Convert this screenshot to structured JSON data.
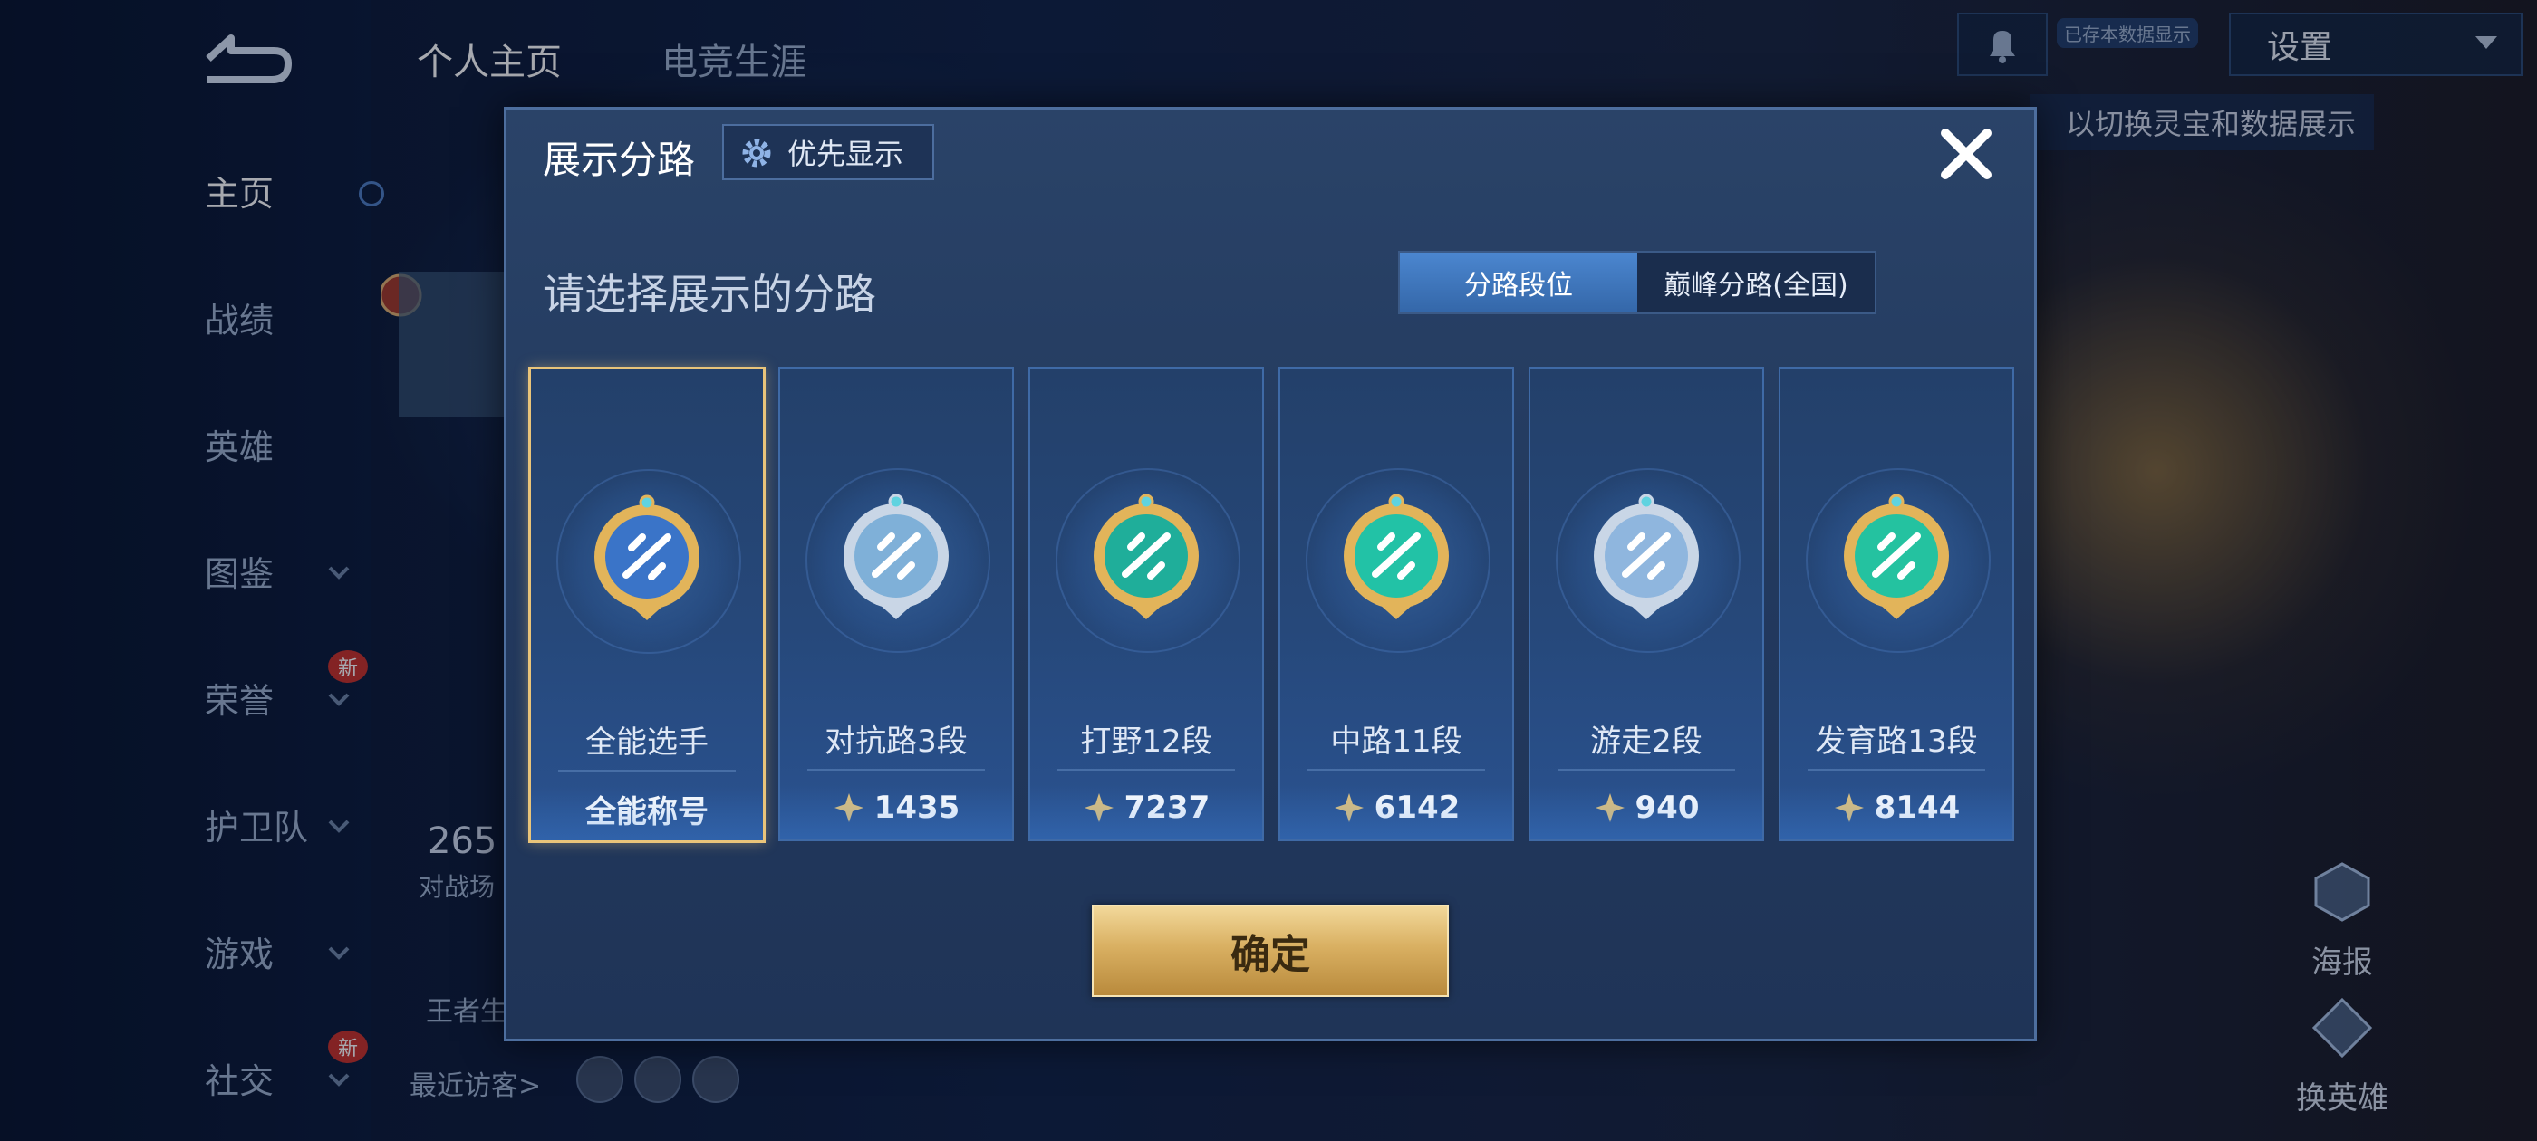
{
  "left_nav": {
    "items": [
      {
        "label": "主页",
        "active": true
      },
      {
        "label": "战绩"
      },
      {
        "label": "英雄"
      },
      {
        "label": "图鉴",
        "has_chevron": true
      },
      {
        "label": "荣誉",
        "has_chevron": true,
        "badge": "新"
      },
      {
        "label": "护卫队",
        "has_chevron": true
      },
      {
        "label": "游戏",
        "has_chevron": true
      },
      {
        "label": "社交",
        "has_chevron": true,
        "badge": "新"
      }
    ]
  },
  "top_tabs": [
    "个人主页",
    "电竞生涯"
  ],
  "top_right": {
    "bell_tip": "已存本数据显示",
    "settings_label": "设置",
    "hint": "以切换灵宝和数据展示"
  },
  "background": {
    "stat_number": "265",
    "stat_label": "对战场",
    "wangzhe_label": "王者生",
    "visitors_label": "最近访客>"
  },
  "right_buttons": [
    "海报",
    "换英雄"
  ],
  "dialog": {
    "title": "展示分路",
    "priority_button": "优先显示",
    "subtitle": "请选择展示的分路",
    "segments": [
      {
        "label": "分路段位",
        "active": true
      },
      {
        "label": "巅峰分路(全国)",
        "active": false
      }
    ],
    "cards": [
      {
        "name": "全能选手",
        "value": "全能称号",
        "selected": true,
        "has_points": false,
        "emblem": "all-round-emblem-icon",
        "tint": "#3a74c8"
      },
      {
        "name": "对抗路3段",
        "value": "1435",
        "selected": false,
        "has_points": true,
        "emblem": "clash-lane-emblem-icon",
        "tint": "#7fb0d8"
      },
      {
        "name": "打野12段",
        "value": "7237",
        "selected": false,
        "has_points": true,
        "emblem": "jungle-emblem-icon",
        "tint": "#1fae9a"
      },
      {
        "name": "中路11段",
        "value": "6142",
        "selected": false,
        "has_points": true,
        "emblem": "mid-lane-emblem-icon",
        "tint": "#22c2a6"
      },
      {
        "name": "游走2段",
        "value": "940",
        "selected": false,
        "has_points": true,
        "emblem": "roam-emblem-icon",
        "tint": "#8fb6de"
      },
      {
        "name": "发育路13段",
        "value": "8144",
        "selected": false,
        "has_points": true,
        "emblem": "farm-lane-emblem-icon",
        "tint": "#24c2a0"
      }
    ],
    "confirm_label": "确定"
  },
  "colors": {
    "gold": "#e9c47a",
    "accent_blue": "#3f7bc6",
    "panel": "#243d63"
  }
}
